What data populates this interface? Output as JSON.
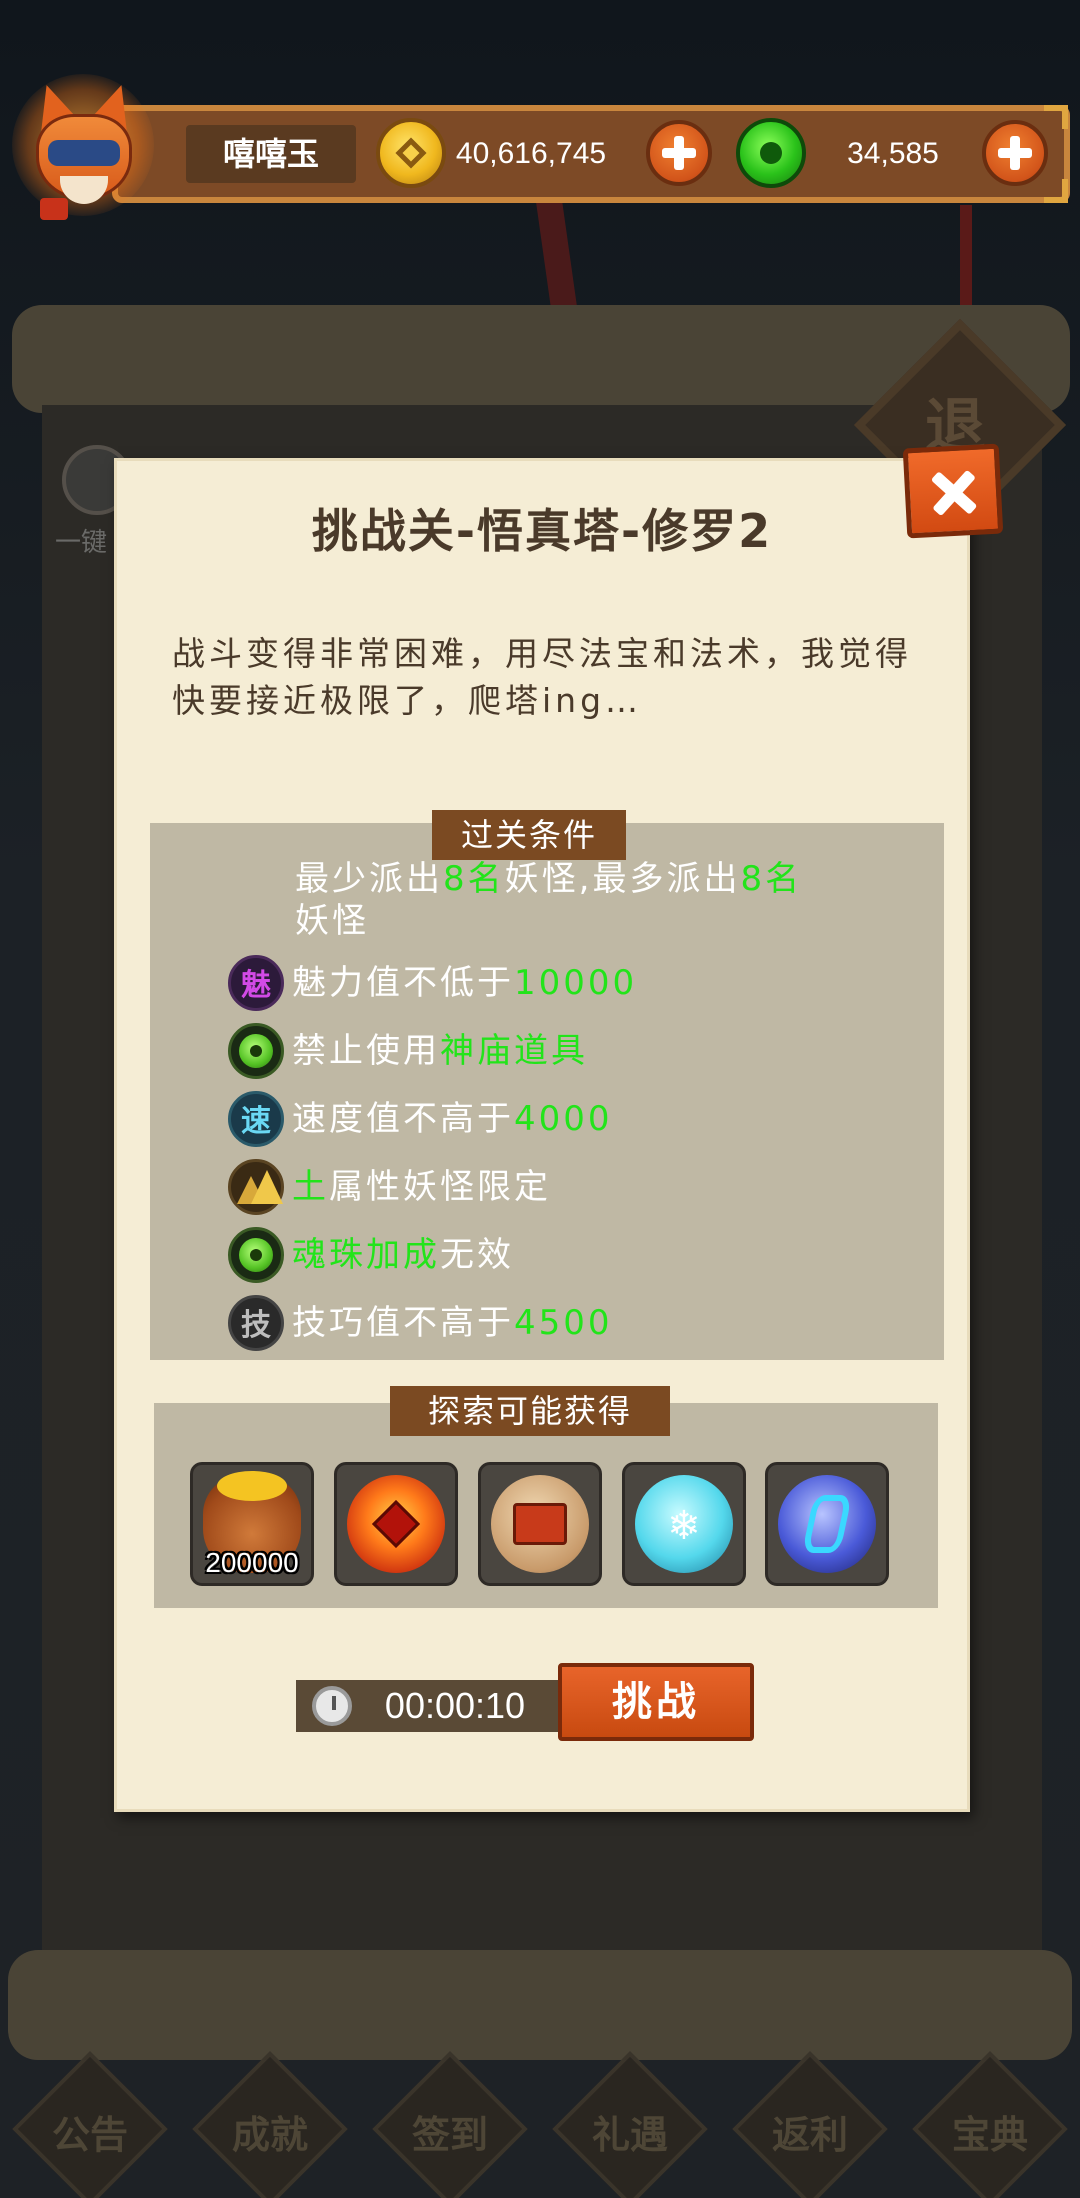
{
  "header": {
    "player_name": "嘻嘻玉",
    "gold": "40,616,745",
    "jade": "34,585"
  },
  "dialog": {
    "title": "挑战关-悟真塔-修罗2",
    "description": "战斗变得非常困难，用尽法宝和法术，我觉得快要接近极限了，爬塔ing…",
    "conditions_label": "过关条件",
    "deploy": {
      "p1": "最少派出",
      "n1": "8名",
      "p2": "妖怪,最多派出",
      "n2": "8名",
      "p3": "妖怪"
    },
    "conditions": [
      {
        "icon": "charm-icon",
        "icon_char": "魅",
        "parts": [
          "魅力值不低于",
          "10000"
        ],
        "green_first": false
      },
      {
        "icon": "soul-bead-icon",
        "icon_char": "",
        "parts": [
          "禁止使用",
          "神庙道具"
        ],
        "green_first": false
      },
      {
        "icon": "speed-icon",
        "icon_char": "速",
        "parts": [
          "速度值不高于",
          "4000"
        ],
        "green_first": false
      },
      {
        "icon": "earth-element-icon",
        "icon_char": "",
        "parts": [
          "土",
          "属性妖怪限定"
        ],
        "green_first": true
      },
      {
        "icon": "soul-bead-icon",
        "icon_char": "",
        "parts": [
          "魂珠加成",
          "无效"
        ],
        "green_first": true
      },
      {
        "icon": "skill-icon",
        "icon_char": "技",
        "parts": [
          "技巧值不高于",
          "4500"
        ],
        "green_first": false
      }
    ],
    "rewards_label": "探索可能获得",
    "rewards": [
      {
        "icon": "coin-bag-icon",
        "qty": "200000"
      },
      {
        "icon": "fire-orb-icon",
        "qty": ""
      },
      {
        "icon": "stone-tablet-orb-icon",
        "qty": ""
      },
      {
        "icon": "ice-orb-icon",
        "qty": ""
      },
      {
        "icon": "blue-crystal-orb-icon",
        "qty": ""
      }
    ],
    "timer": "00:00:10",
    "challenge_label": "挑战"
  },
  "bottom_nav": [
    "公告",
    "成就",
    "签到",
    "礼遇",
    "返利",
    "宝典"
  ],
  "background": {
    "left_label": "一键",
    "sign_char": "退"
  },
  "colors": {
    "highlight_green": "#22e41a",
    "accent_orange": "#d2541a",
    "parchment": "#f5edd5"
  }
}
